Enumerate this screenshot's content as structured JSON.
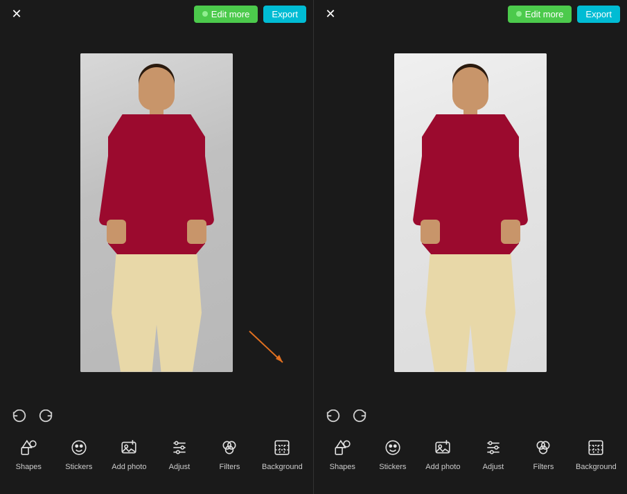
{
  "panels": [
    {
      "id": "left",
      "close_label": "×",
      "edit_more_label": "Edit more",
      "export_label": "Export",
      "undo_tooltip": "Undo",
      "redo_tooltip": "Redo",
      "tools": [
        {
          "id": "shapes",
          "label": "Shapes",
          "icon": "shapes"
        },
        {
          "id": "stickers",
          "label": "Stickers",
          "icon": "stickers"
        },
        {
          "id": "add-photo",
          "label": "Add photo",
          "icon": "add-photo"
        },
        {
          "id": "adjust",
          "label": "Adjust",
          "icon": "adjust"
        },
        {
          "id": "filters",
          "label": "Filters",
          "icon": "filters"
        },
        {
          "id": "background",
          "label": "Background",
          "icon": "background"
        }
      ]
    },
    {
      "id": "right",
      "close_label": "×",
      "edit_more_label": "Edit more",
      "export_label": "Export",
      "undo_tooltip": "Undo",
      "redo_tooltip": "Redo",
      "tools": [
        {
          "id": "shapes",
          "label": "Shapes",
          "icon": "shapes"
        },
        {
          "id": "stickers",
          "label": "Stickers",
          "icon": "stickers"
        },
        {
          "id": "add-photo",
          "label": "Add photo",
          "icon": "add-photo"
        },
        {
          "id": "adjust",
          "label": "Adjust",
          "icon": "adjust"
        },
        {
          "id": "filters",
          "label": "Filters",
          "icon": "filters"
        },
        {
          "id": "background",
          "label": "Background",
          "icon": "background"
        }
      ]
    }
  ],
  "colors": {
    "background": "#1a1a1a",
    "accent_green": "#4cca4c",
    "accent_cyan": "#00bcd4",
    "accent_orange": "#e07020",
    "text_light": "#e0e0e0",
    "text_muted": "#cccccc"
  }
}
